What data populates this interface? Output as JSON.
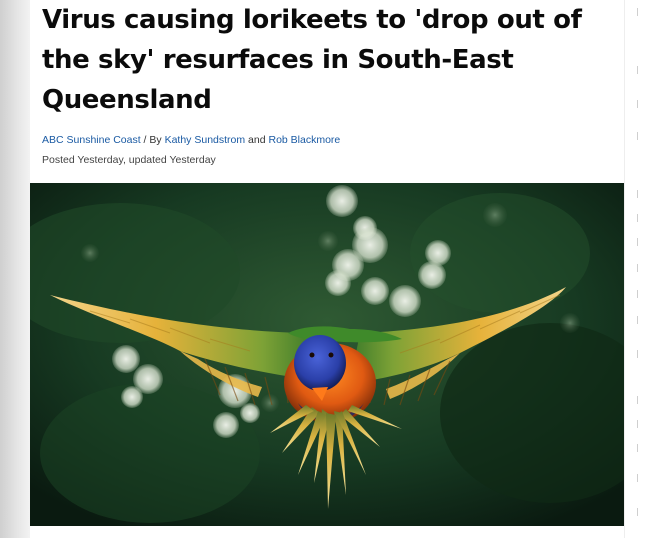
{
  "article": {
    "headline": "Virus causing lorikeets to 'drop out of the sky' resurfaces in South-East Queensland",
    "source": "ABC Sunshine Coast",
    "by_prefix": " / By ",
    "author1": "Kathy Sundstrom",
    "and_text": " and ",
    "author2": "Rob Blackmore",
    "posted": "Posted Yesterday, updated Yesterday"
  },
  "image": {
    "subject": "rainbow lorikeet in flight against blurred green foliage",
    "colors": {
      "background": "#102618",
      "wing": "#d9a02a",
      "head": "#2a3fa8",
      "chest": "#e05a12"
    }
  }
}
